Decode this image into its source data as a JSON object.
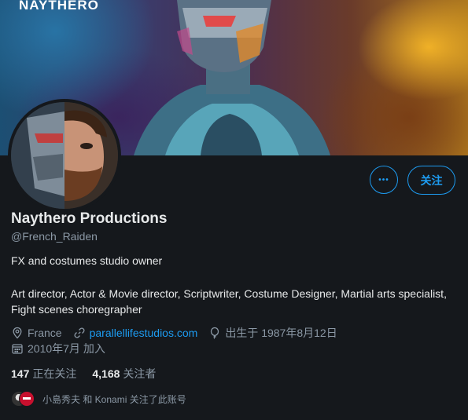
{
  "banner": {
    "brand_text": "NAYTHERO"
  },
  "header": {
    "more_label": "•••",
    "follow_label": "关注"
  },
  "profile": {
    "name": "Naythero Productions",
    "handle": "@French_Raiden",
    "bio_line1": "FX and costumes studio owner",
    "bio_line2": "Art director, Actor & Movie director, Scriptwriter, Costume Designer, Martial arts specialist, Fight scenes choregrapher",
    "location": "France",
    "website": "parallellifestudios.com",
    "birthday": "出生于 1987年8月12日",
    "joined": "2010年7月 加入"
  },
  "stats": {
    "following_count": "147",
    "following_label": "正在关注",
    "followers_count": "4,168",
    "followers_label": "关注者"
  },
  "followed_by": {
    "text": "小島秀夫 和 Konami 关注了此账号"
  },
  "colors": {
    "background": "#15181c",
    "accent": "#1d9bf0",
    "muted_text": "#8b98a5"
  },
  "icons": [
    "location-icon",
    "link-icon",
    "birthday-balloon-icon",
    "calendar-icon",
    "more-icon"
  ]
}
